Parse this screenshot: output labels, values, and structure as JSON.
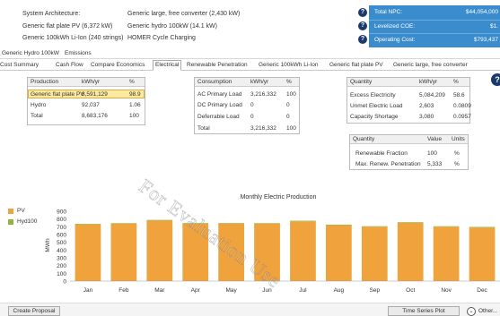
{
  "system": {
    "arch_label": "System Architecture:",
    "components": [
      {
        "name": "Generic flat plate PV (6,372 kW)",
        "name2": "Generic large, free converter (2,430 kW)"
      },
      {
        "name": "Generic flat plate PV (6,372 kW)",
        "name2": "Generic hydro 100kW (14.1 kW)"
      },
      {
        "name": "Generic 100kWh Li-Ion (240 strings)",
        "name2": "HOMER Cycle Charging"
      }
    ],
    "left_col": [
      "System Architecture:",
      "Generic flat plate PV (6,372 kW)",
      "Generic 100kWh Li-Ion (240 strings)"
    ],
    "right_col": [
      "Generic large, free converter (2,430 kW)",
      "Generic hydro 100kW (14.1 kW)",
      "HOMER Cycle Charging"
    ]
  },
  "summary": {
    "npc_label": "Total NPC:",
    "npc_value": "$44,054,000",
    "coe_label": "Levelized COE:",
    "coe_value": "$1.",
    "opcost_label": "Operating Cost:",
    "opcost_value": "$793,437"
  },
  "tabs_top": [
    "Generic Hydro 100kW",
    "Emissions"
  ],
  "tabs_main": [
    "Cost Summary",
    "Cash Flow",
    "Compare Economics",
    "Electrical",
    "Renewable Penetration",
    "Generic 100kWh Li-Ion",
    "Generic flat plate PV",
    "Generic large, free converter"
  ],
  "production": {
    "headers": [
      "Production",
      "kWh/yr",
      "%"
    ],
    "rows": [
      [
        "Generic flat plate PV",
        "8,591,129",
        "98.9"
      ],
      [
        "Hydro",
        "92,037",
        "1.06"
      ],
      [
        "Total",
        "8,683,176",
        "100"
      ]
    ]
  },
  "consumption": {
    "headers": [
      "Consumption",
      "kWh/yr",
      "%"
    ],
    "rows": [
      [
        "AC Primary Load",
        "3,216,332",
        "100"
      ],
      [
        "DC Primary Load",
        "0",
        "0"
      ],
      [
        "Deferrable Load",
        "0",
        "0"
      ],
      [
        "Total",
        "3,216,332",
        "100"
      ]
    ]
  },
  "quantity1": {
    "headers": [
      "Quantity",
      "kWh/yr",
      "%"
    ],
    "rows": [
      [
        "Excess Electricity",
        "5,084,209",
        "58.6"
      ],
      [
        "Unmet Electric Load",
        "2,603",
        "0.0809"
      ],
      [
        "Capacity Shortage",
        "3,080",
        "0.0957"
      ]
    ]
  },
  "quantity2": {
    "headers": [
      "Quantity",
      "Value",
      "Units"
    ],
    "rows": [
      [
        "Renewable Fraction",
        "100",
        "%"
      ],
      [
        "Max. Renew. Penetration",
        "5,333",
        "%"
      ]
    ]
  },
  "watermark": "For Evaluation Use",
  "legend": [
    {
      "name": "PV",
      "color": "#f0a23c"
    },
    {
      "name": "Hyd100",
      "color": "#8fb33c"
    }
  ],
  "chart_data": {
    "type": "bar",
    "title": "Monthly Electric Production",
    "ylabel": "MWh",
    "ylim": [
      0,
      900
    ],
    "yticks": [
      "900",
      "800",
      "700",
      "600",
      "500",
      "400",
      "300",
      "200",
      "100",
      "0"
    ],
    "categories": [
      "Jan",
      "Feb",
      "Mar",
      "Apr",
      "May",
      "Jun",
      "Jul",
      "Aug",
      "Sep",
      "Oct",
      "Nov",
      "Dec"
    ],
    "series": [
      {
        "name": "PV",
        "color": "#f0a23c",
        "values": [
          730,
          740,
          780,
          740,
          740,
          740,
          770,
          720,
          700,
          750,
          700,
          690
        ]
      },
      {
        "name": "Hyd100",
        "color": "#8fb33c",
        "values": [
          8,
          7,
          8,
          8,
          8,
          7,
          8,
          8,
          7,
          8,
          7,
          8
        ]
      }
    ]
  },
  "bottom": {
    "create_label": "Create Proposal",
    "ts_label": "Time Series Plot",
    "other_label": "Other..."
  }
}
